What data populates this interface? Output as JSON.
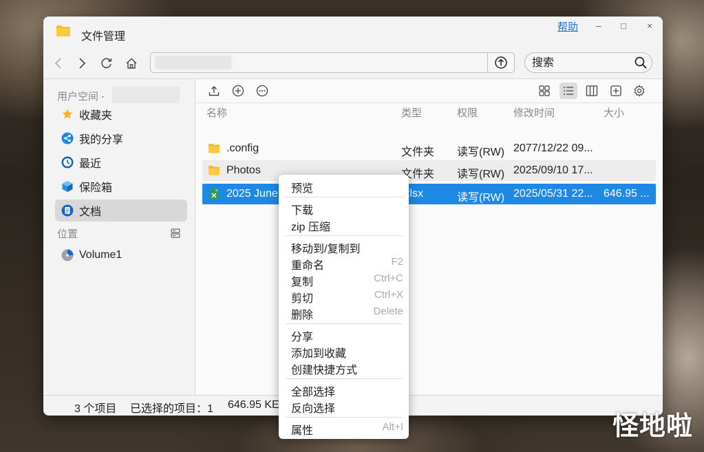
{
  "window": {
    "title": "文件管理",
    "help_label": "帮助",
    "minimize": "–",
    "maximize": "□",
    "close": "×"
  },
  "search": {
    "placeholder": "搜索"
  },
  "sidebar": {
    "user_header": "用户空间 -",
    "items": [
      {
        "label": "收藏夹",
        "icon": "star-icon"
      },
      {
        "label": "我的分享",
        "icon": "share-icon"
      },
      {
        "label": "最近",
        "icon": "clock-icon"
      },
      {
        "label": "保险箱",
        "icon": "safe-box-icon"
      },
      {
        "label": "文档",
        "icon": "document-icon",
        "active": true
      }
    ],
    "location_header": "位置",
    "volumes": [
      {
        "label": "Volume1",
        "icon": "disk-icon"
      }
    ]
  },
  "columns": {
    "name": "名称",
    "type": "类型",
    "permission": "权限",
    "modified": "修改时间",
    "size": "大小"
  },
  "files": [
    {
      "name": ".config",
      "type": "文件夹",
      "permission": "读写(RW)",
      "modified": "2077/12/22 09...",
      "size": "",
      "icon": "folder-icon"
    },
    {
      "name": "Photos",
      "type": "文件夹",
      "permission": "读写(RW)",
      "modified": "2025/09/10 17...",
      "size": "",
      "icon": "folder-icon"
    },
    {
      "name": "2025 June ",
      "type": ".xlsx",
      "permission": "读写(RW)",
      "modified": "2025/05/31 22...",
      "size": "646.95 ...",
      "icon": "excel-file-icon",
      "selected": true
    }
  ],
  "status": {
    "count": "3 个项目",
    "selected": "已选择的项目：1",
    "size": "646.95 KE"
  },
  "context_menu": {
    "groups": [
      [
        {
          "label": "预览",
          "shortcut": ""
        }
      ],
      [
        {
          "label": "下载",
          "shortcut": ""
        },
        {
          "label": "zip 压缩",
          "shortcut": ""
        }
      ],
      [
        {
          "label": "移动到/复制到",
          "shortcut": ""
        },
        {
          "label": "重命名",
          "shortcut": "F2"
        },
        {
          "label": "复制",
          "shortcut": "Ctrl+C"
        },
        {
          "label": "剪切",
          "shortcut": "Ctrl+X"
        },
        {
          "label": "删除",
          "shortcut": "Delete"
        }
      ],
      [
        {
          "label": "分享",
          "shortcut": ""
        },
        {
          "label": "添加到收藏",
          "shortcut": ""
        },
        {
          "label": "创建快捷方式",
          "shortcut": ""
        }
      ],
      [
        {
          "label": "全部选择",
          "shortcut": ""
        },
        {
          "label": "反向选择",
          "shortcut": ""
        }
      ],
      [
        {
          "label": "属性",
          "shortcut": "Alt+I"
        }
      ]
    ]
  },
  "watermark": "怪地啦",
  "colors": {
    "accent": "#1e88e5",
    "folder": "#f7b92c",
    "help_link": "#1a73d6"
  }
}
